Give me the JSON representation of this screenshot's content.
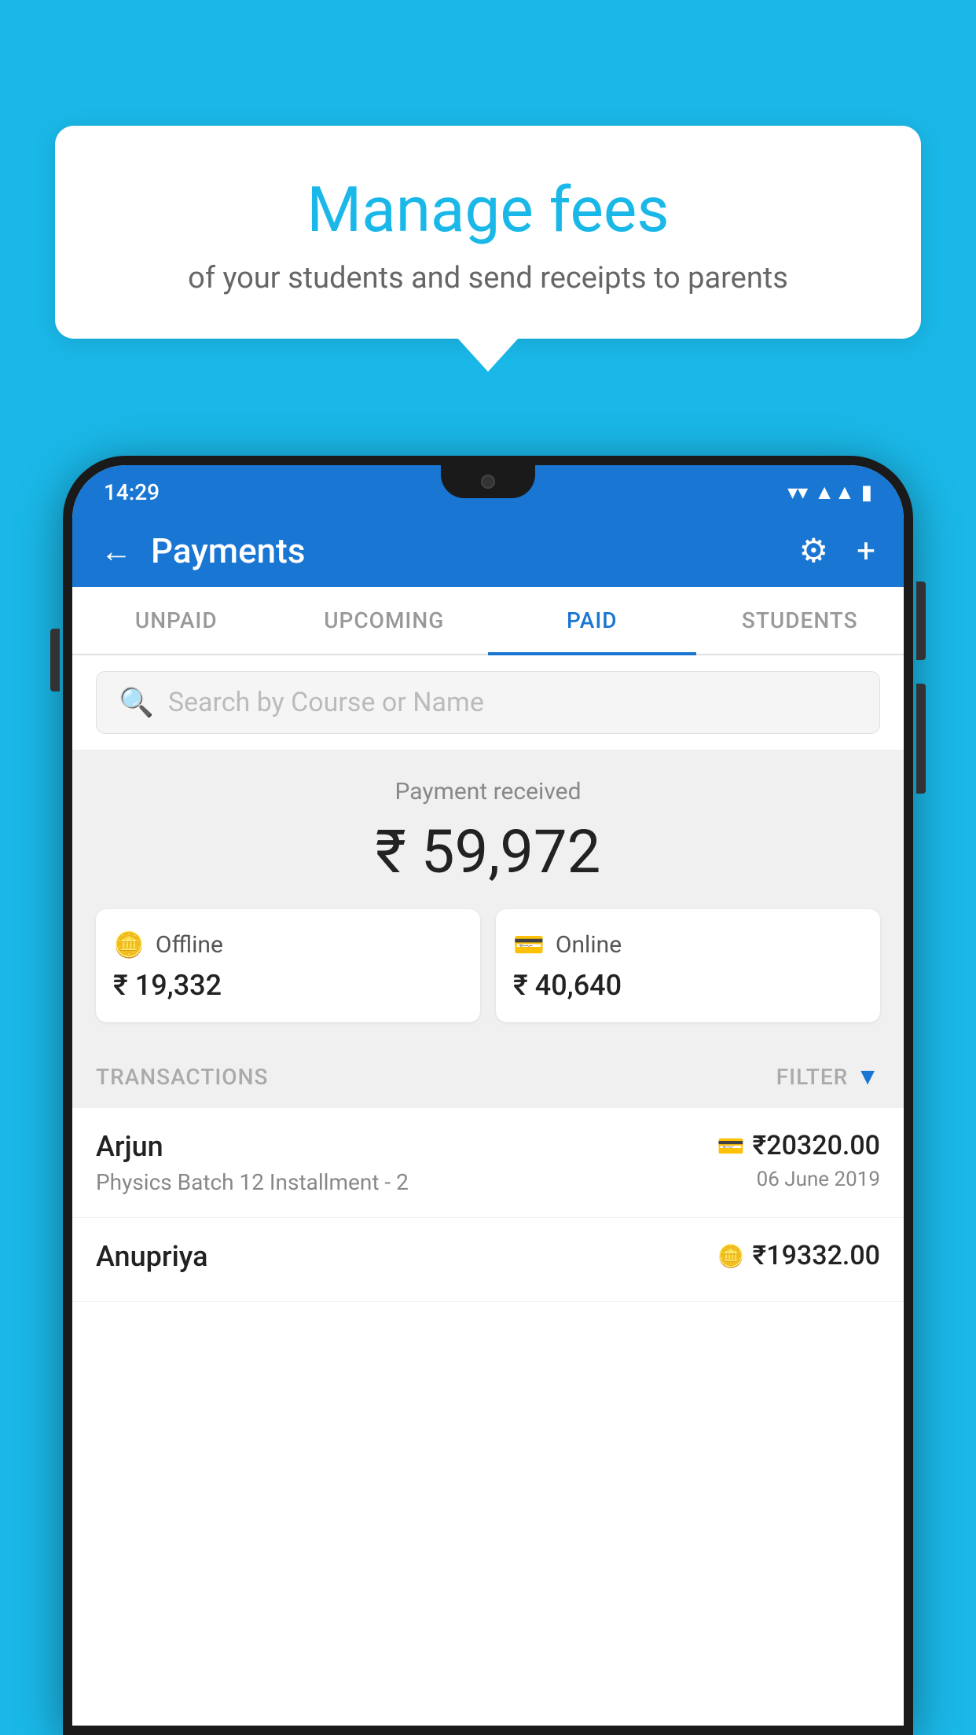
{
  "background_color": "#1ab8e8",
  "tooltip": {
    "title": "Manage fees",
    "subtitle": "of your students and send receipts to parents"
  },
  "phone": {
    "status_bar": {
      "time": "14:29",
      "wifi": "▼",
      "signal": "▲",
      "battery": "▮"
    },
    "app_bar": {
      "title": "Payments",
      "back_label": "←",
      "gear_label": "⚙",
      "plus_label": "+"
    },
    "tabs": [
      {
        "label": "UNPAID",
        "active": false
      },
      {
        "label": "UPCOMING",
        "active": false
      },
      {
        "label": "PAID",
        "active": true
      },
      {
        "label": "STUDENTS",
        "active": false
      }
    ],
    "search": {
      "placeholder": "Search by Course or Name"
    },
    "payment_summary": {
      "label": "Payment received",
      "total": "₹ 59,972",
      "offline": {
        "icon": "💳",
        "type": "Offline",
        "amount": "₹ 19,332"
      },
      "online": {
        "icon": "💳",
        "type": "Online",
        "amount": "₹ 40,640"
      }
    },
    "transactions": {
      "label": "TRANSACTIONS",
      "filter_label": "FILTER",
      "items": [
        {
          "name": "Arjun",
          "course": "Physics Batch 12 Installment - 2",
          "amount": "₹20320.00",
          "date": "06 June 2019",
          "payment_type": "online"
        },
        {
          "name": "Anupriya",
          "course": "",
          "amount": "₹19332.00",
          "date": "",
          "payment_type": "offline"
        }
      ]
    }
  }
}
